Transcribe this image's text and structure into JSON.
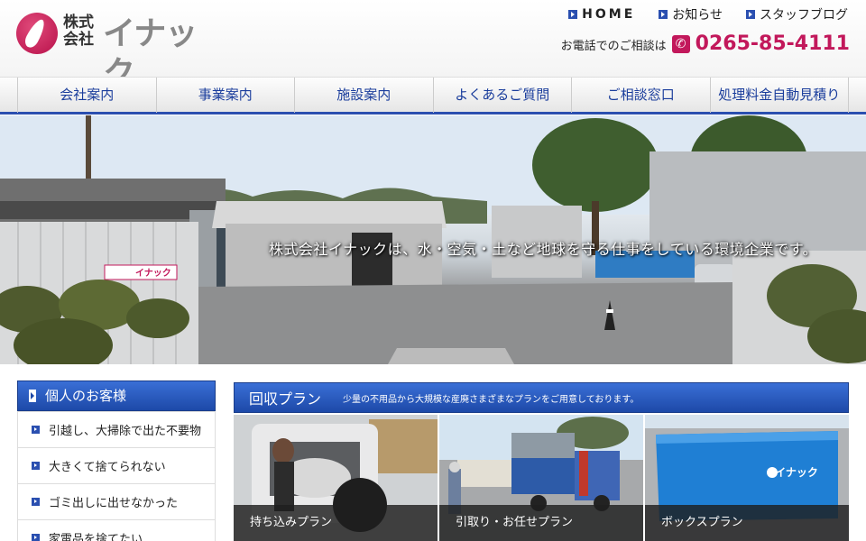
{
  "header": {
    "logo_prefix_line1": "株式",
    "logo_prefix_line2": "会社",
    "logo_name": "イナック",
    "top_nav": [
      {
        "label": "HOME"
      },
      {
        "label": "お知らせ"
      },
      {
        "label": "スタッフブログ"
      }
    ],
    "phone_label": "お電話でのご相談は",
    "phone_number": "0265-85-4111"
  },
  "main_nav": [
    {
      "label": "会社案内"
    },
    {
      "label": "事業案内"
    },
    {
      "label": "施設案内"
    },
    {
      "label": "よくあるご質問"
    },
    {
      "label": "ご相談窓口"
    },
    {
      "label": "処理料金自動見積り"
    }
  ],
  "hero": {
    "caption": "株式会社イナックは、水・空気・土など地球を守る仕事をしている環境企業です。",
    "sign_text": "イナック"
  },
  "sidebar": {
    "title": "個人のお客様",
    "items": [
      {
        "label": "引越し、大掃除で出た不要物"
      },
      {
        "label": "大きくて捨てられない"
      },
      {
        "label": "ゴミ出しに出せなかった"
      },
      {
        "label": "家電品を捨てたい"
      }
    ]
  },
  "plan": {
    "title": "回収プラン",
    "subtitle": "少量の不用品から大規模な産廃さまざまなプランをご用意しております。",
    "cards": [
      {
        "label": "持ち込みプラン"
      },
      {
        "label": "引取り・お任せプラン"
      },
      {
        "label": "ボックスプラン"
      }
    ],
    "box_logo": "イナック"
  },
  "colors": {
    "brand_magenta": "#c2185b",
    "nav_blue": "#2a4fb0",
    "nav_text": "#1a3d9c"
  }
}
